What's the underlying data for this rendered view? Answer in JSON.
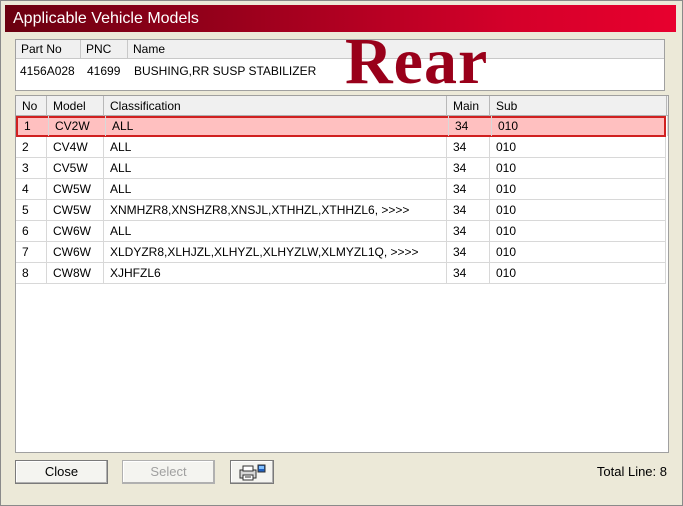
{
  "window": {
    "title": "Applicable Vehicle Models"
  },
  "part": {
    "headers": {
      "part_no": "Part No",
      "pnc": "PNC",
      "name": "Name"
    },
    "part_no": "4156A028",
    "pnc": "41699",
    "name": "BUSHING,RR SUSP STABILIZER"
  },
  "overlay": {
    "rear_label": "Rear"
  },
  "table": {
    "headers": {
      "no": "No",
      "model": "Model",
      "classification": "Classification",
      "main": "Main",
      "sub": "Sub"
    },
    "rows": [
      {
        "no": "1",
        "model": "CV2W",
        "classification": "ALL",
        "main": "34",
        "sub": "010"
      },
      {
        "no": "2",
        "model": "CV4W",
        "classification": "ALL",
        "main": "34",
        "sub": "010"
      },
      {
        "no": "3",
        "model": "CV5W",
        "classification": "ALL",
        "main": "34",
        "sub": "010"
      },
      {
        "no": "4",
        "model": "CW5W",
        "classification": "ALL",
        "main": "34",
        "sub": "010"
      },
      {
        "no": "5",
        "model": "CW5W",
        "classification": "XNMHZR8,XNSHZR8,XNSJL,XTHHZL,XTHHZL6,  >>>>",
        "main": "34",
        "sub": "010"
      },
      {
        "no": "6",
        "model": "CW6W",
        "classification": "ALL",
        "main": "34",
        "sub": "010"
      },
      {
        "no": "7",
        "model": "CW6W",
        "classification": "XLDYZR8,XLHJZL,XLHYZL,XLHYZLW,XLMYZL1Q,  >>>>",
        "main": "34",
        "sub": "010"
      },
      {
        "no": "8",
        "model": "CW8W",
        "classification": "XJHFZL6",
        "main": "34",
        "sub": "010"
      }
    ]
  },
  "buttons": {
    "close": "Close",
    "select": "Select",
    "print_icon": "printer-icon"
  },
  "status": {
    "total_line": "Total Line: 8"
  },
  "colors": {
    "title_gradient_end": "#e8002e",
    "selected_row_bg": "#ffc0c0",
    "selected_row_border": "#d02020",
    "rear_label": "#99001a"
  }
}
